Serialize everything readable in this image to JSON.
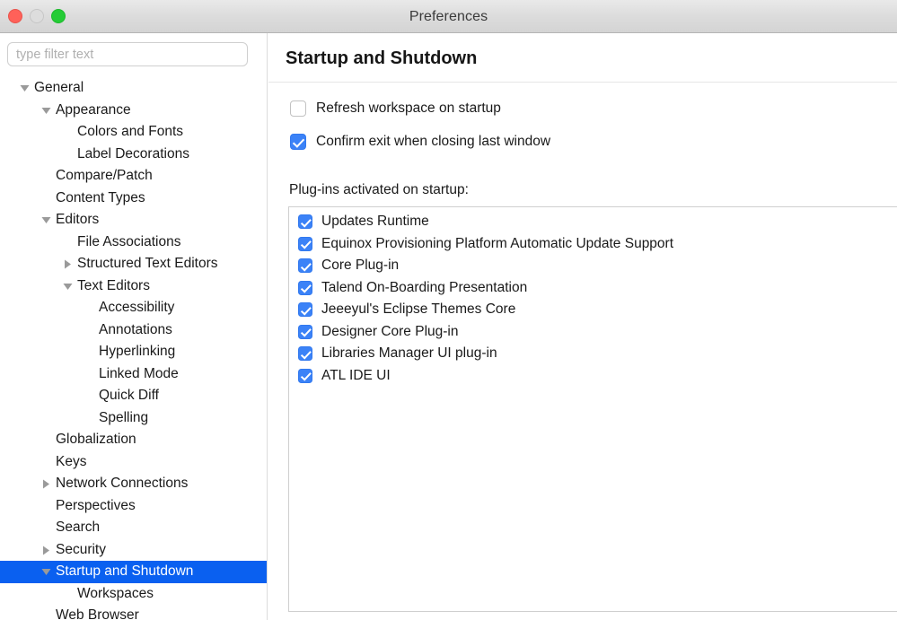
{
  "window": {
    "title": "Preferences",
    "traffic_lights": [
      {
        "name": "close",
        "color": "#ff6159"
      },
      {
        "name": "minimize",
        "color": "#dddddd"
      },
      {
        "name": "zoom",
        "color": "#25cc36"
      }
    ]
  },
  "sidebar": {
    "filter": {
      "placeholder": "type filter text",
      "value": ""
    },
    "tree": [
      {
        "label": "General",
        "indent": 0,
        "twisty": "down",
        "selected": false
      },
      {
        "label": "Appearance",
        "indent": 1,
        "twisty": "down",
        "selected": false
      },
      {
        "label": "Colors and Fonts",
        "indent": 2,
        "twisty": "none",
        "selected": false
      },
      {
        "label": "Label Decorations",
        "indent": 2,
        "twisty": "none",
        "selected": false
      },
      {
        "label": "Compare/Patch",
        "indent": 1,
        "twisty": "none",
        "selected": false
      },
      {
        "label": "Content Types",
        "indent": 1,
        "twisty": "none",
        "selected": false
      },
      {
        "label": "Editors",
        "indent": 1,
        "twisty": "down",
        "selected": false
      },
      {
        "label": "File Associations",
        "indent": 2,
        "twisty": "none",
        "selected": false
      },
      {
        "label": "Structured Text Editors",
        "indent": 2,
        "twisty": "right",
        "selected": false
      },
      {
        "label": "Text Editors",
        "indent": 2,
        "twisty": "down",
        "selected": false
      },
      {
        "label": "Accessibility",
        "indent": 3,
        "twisty": "none",
        "selected": false
      },
      {
        "label": "Annotations",
        "indent": 3,
        "twisty": "none",
        "selected": false
      },
      {
        "label": "Hyperlinking",
        "indent": 3,
        "twisty": "none",
        "selected": false
      },
      {
        "label": "Linked Mode",
        "indent": 3,
        "twisty": "none",
        "selected": false
      },
      {
        "label": "Quick Diff",
        "indent": 3,
        "twisty": "none",
        "selected": false
      },
      {
        "label": "Spelling",
        "indent": 3,
        "twisty": "none",
        "selected": false
      },
      {
        "label": "Globalization",
        "indent": 1,
        "twisty": "none",
        "selected": false
      },
      {
        "label": "Keys",
        "indent": 1,
        "twisty": "none",
        "selected": false
      },
      {
        "label": "Network Connections",
        "indent": 1,
        "twisty": "right",
        "selected": false
      },
      {
        "label": "Perspectives",
        "indent": 1,
        "twisty": "none",
        "selected": false
      },
      {
        "label": "Search",
        "indent": 1,
        "twisty": "none",
        "selected": false
      },
      {
        "label": "Security",
        "indent": 1,
        "twisty": "right",
        "selected": false
      },
      {
        "label": "Startup and Shutdown",
        "indent": 1,
        "twisty": "down",
        "selected": true
      },
      {
        "label": "Workspaces",
        "indent": 2,
        "twisty": "none",
        "selected": false
      },
      {
        "label": "Web Browser",
        "indent": 1,
        "twisty": "none",
        "selected": false
      }
    ],
    "selection_color": "#0a60f0"
  },
  "main": {
    "page_title": "Startup and Shutdown",
    "options": [
      {
        "label": "Refresh workspace on startup",
        "checked": false
      },
      {
        "label": "Confirm exit when closing last window",
        "checked": true
      }
    ],
    "plugins_label": "Plug-ins activated on startup:",
    "plugins": [
      {
        "label": "Updates Runtime",
        "checked": true
      },
      {
        "label": "Equinox Provisioning Platform Automatic Update Support",
        "checked": true
      },
      {
        "label": "Core Plug-in",
        "checked": true
      },
      {
        "label": "Talend On-Boarding Presentation",
        "checked": true
      },
      {
        "label": "Jeeeyul's Eclipse Themes Core",
        "checked": true
      },
      {
        "label": "Designer Core Plug-in",
        "checked": true
      },
      {
        "label": "Libraries Manager UI plug-in",
        "checked": true
      },
      {
        "label": "ATL IDE UI",
        "checked": true
      }
    ],
    "checkbox_accent": "#3b82f7"
  }
}
